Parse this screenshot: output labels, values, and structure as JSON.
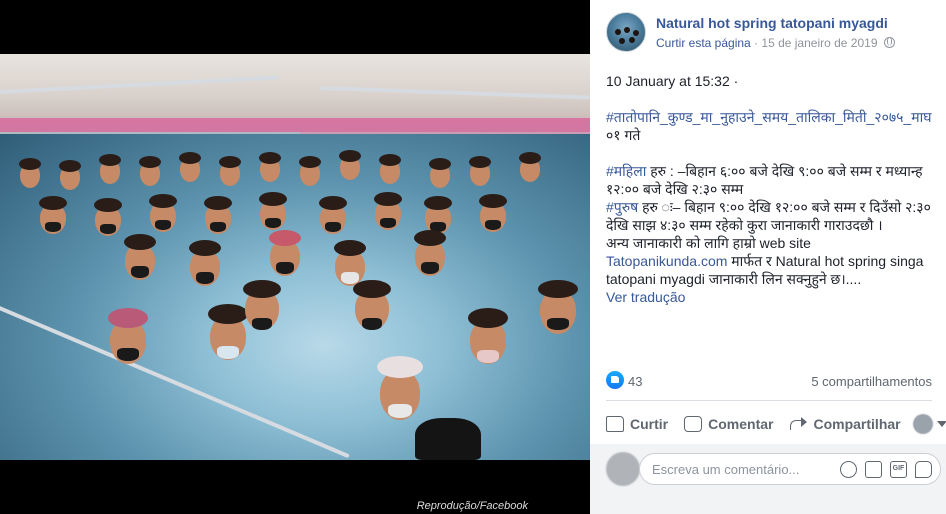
{
  "media": {
    "credit": "Reprodução/Facebook"
  },
  "header": {
    "page_name": "Natural hot spring tatopani myagdi",
    "like_page": "Curtir esta página",
    "separator": " · ",
    "date": "15 de janeiro de 2019",
    "privacy_icon": "globe-icon"
  },
  "post": {
    "line_timestamp": "10 January at 15:32 ·",
    "hashtag_1": "#तातोपानि_कुण्ड_मा_नुहाउने_समय_तालिका_मिती_२०७५_माघ",
    "hashtag_1_tail": " ०१ गते",
    "women_tag": "#महिला",
    "women_text": " हरु : –बिहान ६:०० बजे देखि ९:०० बजे सम्म र मध्यान्ह १२:०० बजे देखि २:३० सम्म",
    "men_tag": "#पुरुष",
    "men_text": " हरु ः– बिहान ९:०० देखि १२:०० बजे सम्म र दिउँसो २:३० देखि साझ ४:३० सम्म रहेको कुरा जानाकारी गाराउदछौ ।",
    "info_prefix": "अन्य जानाकारी को लागि हाम्रो web site",
    "info_link": "Tatopanikunda.com",
    "info_suffix": " मार्फत र Natural hot spring singa tatopani myagdi जानाकारी लिन सक्नुहुने छ।....",
    "see_translation": "Ver tradução"
  },
  "reactions": {
    "like_count": "43",
    "shares": "5 compartilhamentos"
  },
  "actions": {
    "like": "Curtir",
    "comment": "Comentar",
    "share": "Compartilhar"
  },
  "comment_box": {
    "placeholder": "Escreva um comentário..."
  },
  "colors": {
    "link": "#385898",
    "text": "#1d2129",
    "muted": "#90949c",
    "like_blue": "#1877f2"
  }
}
